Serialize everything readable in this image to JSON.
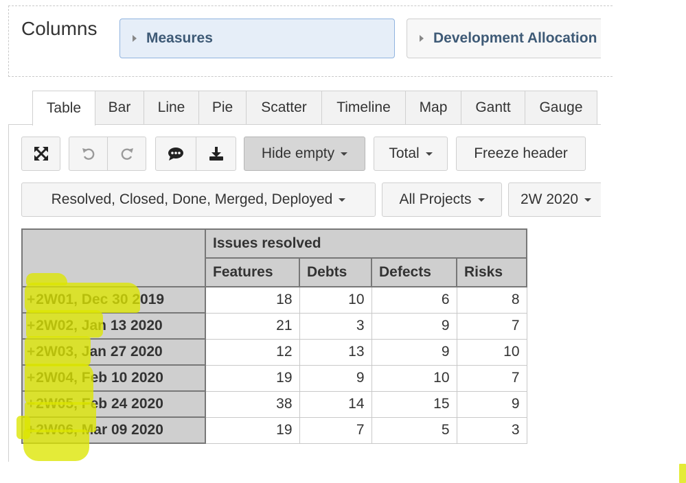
{
  "columns": {
    "label": "Columns",
    "dimensions": [
      "Measures",
      "Development Allocation"
    ]
  },
  "tabs": [
    "Table",
    "Bar",
    "Line",
    "Pie",
    "Scatter",
    "Timeline",
    "Map",
    "Gantt",
    "Gauge"
  ],
  "active_tab": "Table",
  "toolbar": {
    "expand_icon": "expand-arrows-icon",
    "undo_icon": "undo-icon",
    "redo_icon": "redo-icon",
    "comment_icon": "comment-icon",
    "export_icon": "download-icon",
    "hide_empty": "Hide empty",
    "total": "Total",
    "freeze_header": "Freeze header"
  },
  "filters": {
    "status": "Resolved, Closed, Done, Merged, Deployed",
    "project": "All Projects",
    "period": "2W 2020"
  },
  "table": {
    "group_header": "Issues resolved",
    "columns": [
      "Features",
      "Debts",
      "Defects",
      "Risks"
    ],
    "rows": [
      {
        "label": "2W01, Dec 30 2019",
        "values": [
          "18",
          "10",
          "6",
          "8"
        ]
      },
      {
        "label": "2W02, Jan 13 2020",
        "values": [
          "21",
          "3",
          "9",
          "7"
        ]
      },
      {
        "label": "2W03, Jan 27 2020",
        "values": [
          "12",
          "13",
          "9",
          "10"
        ]
      },
      {
        "label": "2W04, Feb 10 2020",
        "values": [
          "19",
          "9",
          "10",
          "7"
        ]
      },
      {
        "label": "2W05, Feb 24 2020",
        "values": [
          "38",
          "14",
          "15",
          "9"
        ]
      },
      {
        "label": "2W06, Mar 09 2020",
        "values": [
          "19",
          "7",
          "5",
          "3"
        ]
      }
    ]
  },
  "highlight_color": "#dce600"
}
